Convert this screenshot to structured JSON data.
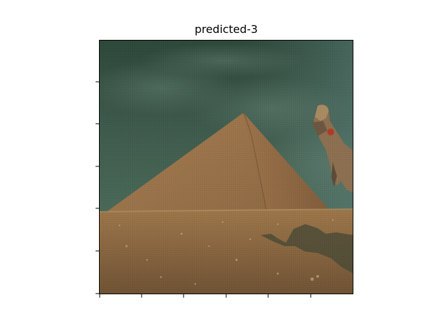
{
  "figure": {
    "title": "predicted-3"
  },
  "image": {
    "description_icon": "pyramid-photo",
    "colors": {
      "sky_top": "#2f4a3b",
      "sky_mid": "#3f5a4b",
      "pyramid_light": "#a3784c",
      "pyramid_dark": "#7d5a3a",
      "sand_top": "#9a744a",
      "sand_bottom": "#6f5233",
      "shadow": "#4a4a3a"
    }
  },
  "axes": {
    "show_tick_labels": false,
    "frame_color": "#000000"
  }
}
